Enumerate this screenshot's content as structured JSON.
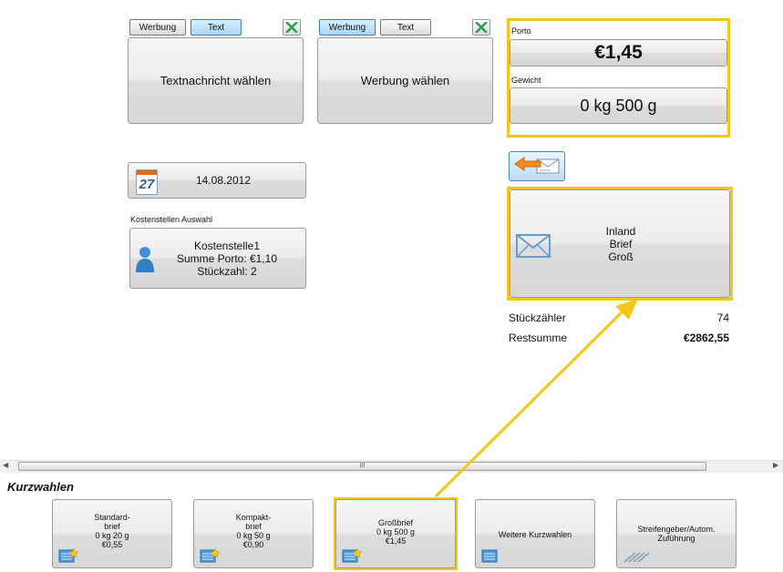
{
  "left_panel": {
    "tab_werbung": "Werbung",
    "tab_text": "Text",
    "main_button": "Textnachricht wählen"
  },
  "mid_panel": {
    "tab_werbung": "Werbung",
    "tab_text": "Text",
    "main_button": "Werbung wählen"
  },
  "porto": {
    "label": "Porto",
    "value": "€1,45"
  },
  "gewicht": {
    "label": "Gewicht",
    "value": "0 kg 500 g"
  },
  "date_button": {
    "value": "14.08.2012",
    "calendar_day": "27"
  },
  "kostenstelle": {
    "section_label": "Kostenstellen Auswahl",
    "name": "Kostenstelle1",
    "summe": "Summe Porto: €1,10",
    "stueck": "Stückzahl: 2"
  },
  "product": {
    "line1": "Inland",
    "line2": "Brief",
    "line3": "Groß"
  },
  "counters": {
    "stueck_label": "Stückzähler",
    "stueck_value": "74",
    "rest_label": "Restsumme",
    "rest_value": "€2862,55"
  },
  "scrollbar": {
    "grip": "III"
  },
  "kurzwahlen": {
    "heading": "Kurzwahlen",
    "items": [
      {
        "text": "Standard-\nbrief\n0 kg 20 g\n€0,55"
      },
      {
        "text": "Kompakt-\nbrief\n0 kg 50 g\n€0,90"
      },
      {
        "text": "Großbrief\n0 kg 500 g\n€1,45"
      },
      {
        "text": "Weitere Kurzwahlen"
      },
      {
        "text": "Streifengeber/Autom.\nZuführung"
      }
    ]
  },
  "colors": {
    "highlight": "#f5c518",
    "accent_blue": "#3c7fb1"
  }
}
